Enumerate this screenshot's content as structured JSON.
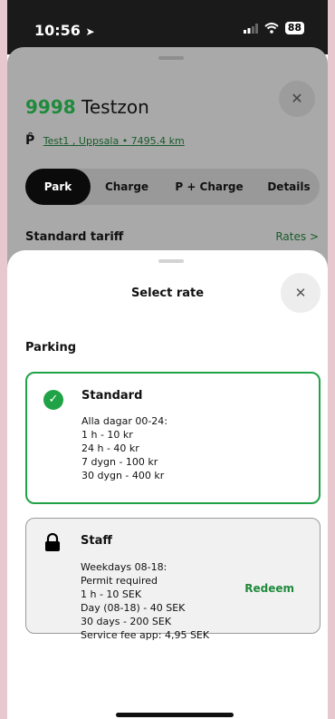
{
  "status": {
    "time": "10:56",
    "battery": "88"
  },
  "zone": {
    "number": "9998",
    "name": "Testzon"
  },
  "location": {
    "text": "Test1 , Uppsala • 7495.4 km"
  },
  "tabs": [
    {
      "label": "Park"
    },
    {
      "label": "Charge"
    },
    {
      "label": "P + Charge"
    },
    {
      "label": "Details"
    }
  ],
  "tariff": {
    "label": "Standard tariff",
    "rates_link": "Rates >"
  },
  "sheet": {
    "title": "Select rate",
    "section": "Parking"
  },
  "rates": [
    {
      "name": "Standard",
      "selected": true,
      "lines": [
        "Alla dagar 00-24:",
        "1 h - 10 kr",
        "24 h - 40 kr",
        "7 dygn - 100 kr",
        "30 dygn - 400 kr"
      ]
    },
    {
      "name": "Staff",
      "locked": true,
      "action": "Redeem",
      "lines": [
        "Weekdays 08-18:",
        "Permit required",
        "1 h - 10 SEK",
        "Day (08-18) - 40 SEK",
        "30 days - 200 SEK",
        "Service fee app: 4,95 SEK"
      ]
    }
  ],
  "colors": {
    "accent": "#1fa346",
    "dark": "#0b0b0b",
    "link": "#185c2a"
  }
}
